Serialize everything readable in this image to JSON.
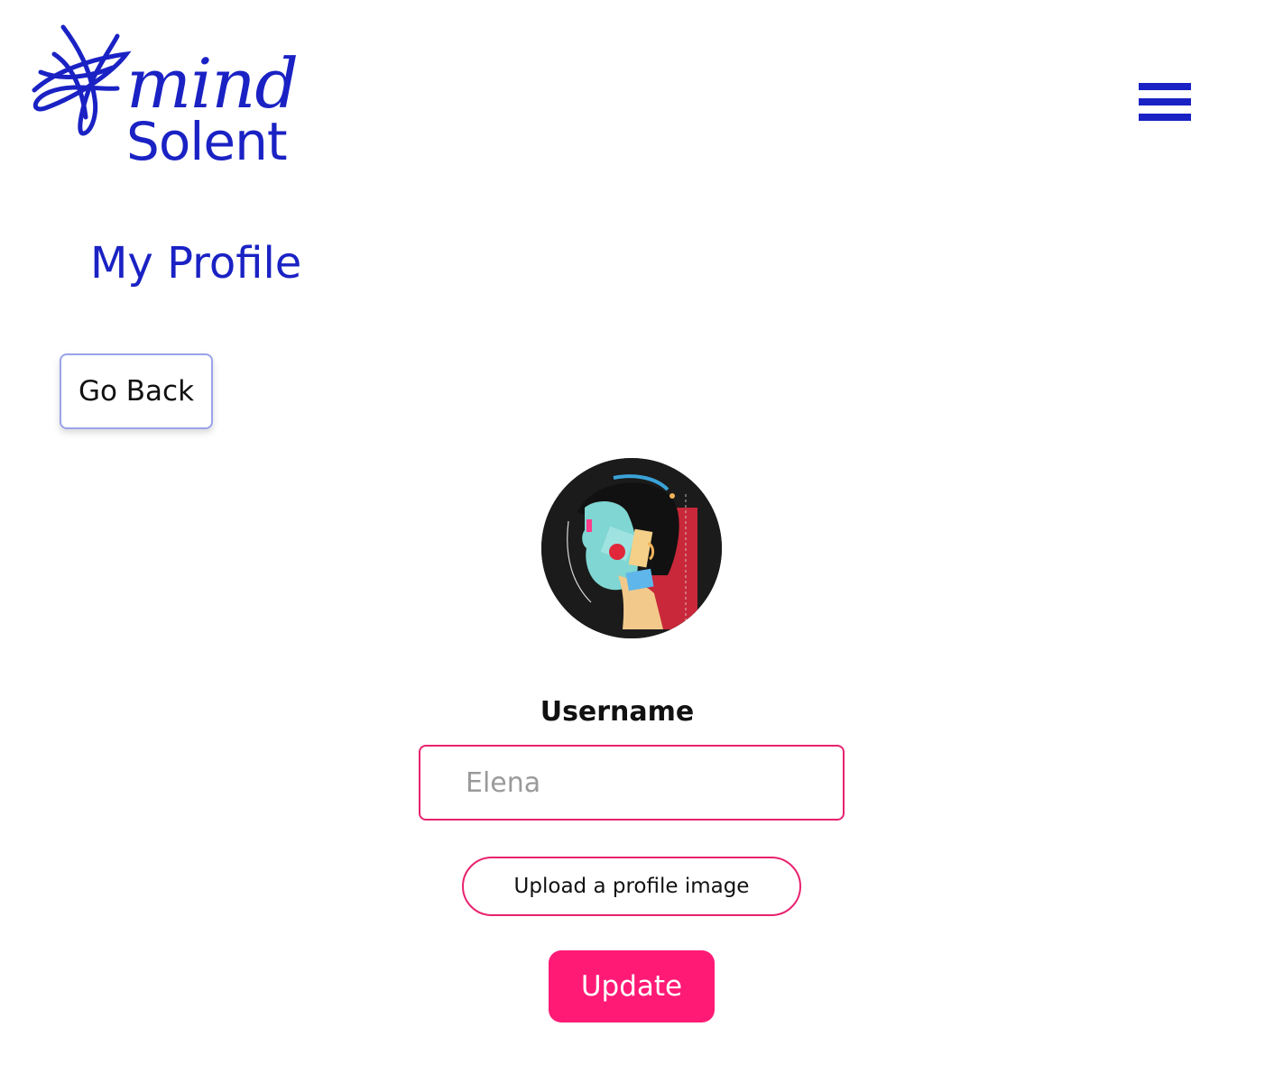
{
  "header": {
    "logo": {
      "line1": "mind",
      "line2": "Solent",
      "icon": "mind-scribble-logo-icon"
    },
    "menu_icon": "hamburger-menu-icon"
  },
  "page": {
    "title": "My Profile"
  },
  "actions": {
    "go_back_label": "Go Back"
  },
  "profile": {
    "avatar_icon": "profile-avatar-illustration",
    "username_label": "Username",
    "username_placeholder": "Elena",
    "upload_label": "Upload a profile image",
    "update_label": "Update"
  },
  "colors": {
    "brand_blue": "#1a22c4",
    "accent_pink": "#ff1a76",
    "input_border": "#e8226f",
    "go_back_border": "#9aa3ea"
  }
}
